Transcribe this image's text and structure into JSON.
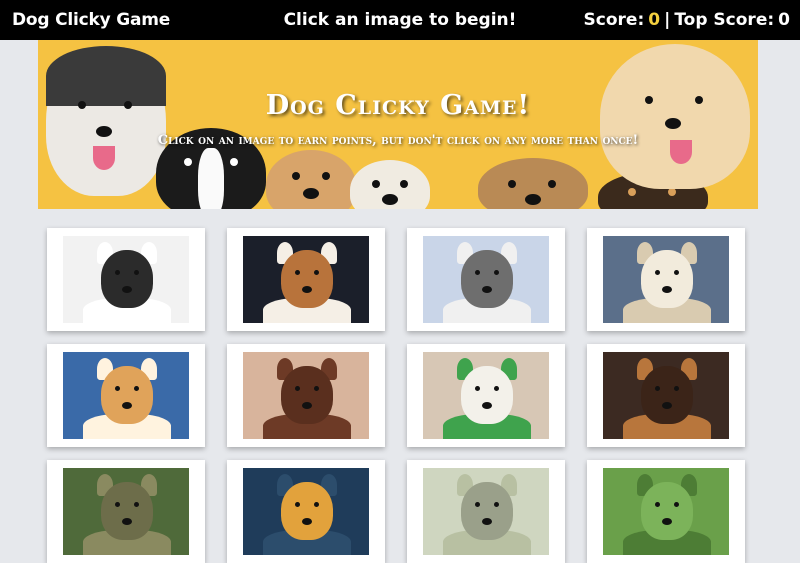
{
  "navbar": {
    "brand": "Dog Clicky Game",
    "message": "Click an image to begin!",
    "score_label": "Score:",
    "score_value": "0",
    "separator": "|",
    "top_score_label": "Top Score:",
    "top_score_value": "0"
  },
  "hero": {
    "title": "Dog Clicky Game!",
    "subtitle": "Click on an image to earn points, but don't click on any more than once!"
  },
  "colors": {
    "navbar_bg": "#000000",
    "score_accent": "#f4d03f",
    "hero_bg": "#f5c242",
    "page_bg": "#e6e8ec",
    "card_bg": "#ffffff"
  },
  "cards": [
    {
      "name": "boston-terrier-puppy",
      "bg": "#f2f2f2",
      "fur": "#2b2b2b",
      "alt": "#ffffff"
    },
    {
      "name": "beagle-puppy",
      "bg": "#1b1f2a",
      "fur": "#b8733b",
      "alt": "#f5efe6"
    },
    {
      "name": "husky-in-snow",
      "bg": "#c9d5e8",
      "fur": "#6e6e6e",
      "alt": "#f0f0f0"
    },
    {
      "name": "maltese-on-bed",
      "bg": "#5b6f8a",
      "fur": "#f2ebdc",
      "alt": "#d9cbb0"
    },
    {
      "name": "pomeranian-on-jeans",
      "bg": "#3a6aa8",
      "fur": "#e0a35a",
      "alt": "#fff3df"
    },
    {
      "name": "brown-poodle",
      "bg": "#d8b49c",
      "fur": "#5a2f1e",
      "alt": "#6d3a26"
    },
    {
      "name": "white-dog-green-hat",
      "bg": "#d7c7b5",
      "fur": "#f3f1ea",
      "alt": "#3fa34d"
    },
    {
      "name": "chihuahua-pinscher",
      "bg": "#3c2a22",
      "fur": "#3b2418",
      "alt": "#b8763c"
    },
    {
      "name": "dog-row3-1",
      "bg": "#4f6a3a",
      "fur": "#6d6d4a",
      "alt": "#8a8a60"
    },
    {
      "name": "dog-row3-2",
      "bg": "#1f3c5a",
      "fur": "#e2a23c",
      "alt": "#2c4d6c"
    },
    {
      "name": "dog-row3-3",
      "bg": "#cfd6c0",
      "fur": "#9aa08a",
      "alt": "#b8c0a2"
    },
    {
      "name": "dog-row3-4",
      "bg": "#6aa04a",
      "fur": "#7cb35a",
      "alt": "#4d7d35"
    }
  ]
}
